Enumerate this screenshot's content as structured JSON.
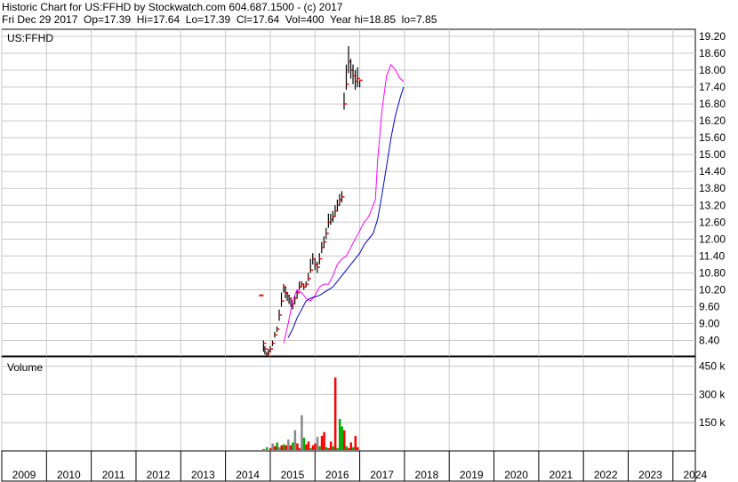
{
  "header": {
    "line1": "Historic Chart for US:FFHD by Stockwatch.com 604.687.1500 - (c) 2017",
    "line2": "Fri Dec 29 2017  Op=17.39  Hi=17.64  Lo=17.39  Cl=17.64  Vol=400  Year hi=18.85  lo=7.85"
  },
  "colors": {
    "grid": "#c8c8c8",
    "price_bar": "#000000",
    "price_point": "#ff0000",
    "ma_short": "#ff00ff",
    "ma_long": "#0000cc",
    "vol_up": "#00b000",
    "vol_down": "#ff0000",
    "vol_neutral": "#888888"
  },
  "chart_data": [
    {
      "type": "line",
      "title": "US:FFHD",
      "ylim": [
        7.85,
        19.45
      ],
      "yticks": [
        "19.20",
        "18.60",
        "18.00",
        "17.40",
        "16.80",
        "16.20",
        "15.60",
        "15.00",
        "14.40",
        "13.80",
        "13.20",
        "12.60",
        "12.00",
        "11.40",
        "10.80",
        "10.20",
        "9.60",
        "9.00",
        "8.40"
      ],
      "ytick_values": [
        19.2,
        18.6,
        18.0,
        17.4,
        16.8,
        16.2,
        15.6,
        15.0,
        14.4,
        13.8,
        13.2,
        12.6,
        12.0,
        11.4,
        10.8,
        10.2,
        9.6,
        9.0,
        8.4
      ],
      "xlim": [
        2009.0,
        2024.5
      ],
      "xticks": [
        "2009",
        "2010",
        "2011",
        "2012",
        "2013",
        "2014",
        "2015",
        "2016",
        "2017",
        "2018",
        "2019",
        "2020",
        "2021",
        "2022",
        "2023",
        "2024"
      ],
      "xtick_values": [
        2009,
        2010,
        2011,
        2012,
        2013,
        2014,
        2015,
        2016,
        2017,
        2018,
        2019,
        2020,
        2021,
        2022,
        2023,
        2024
      ],
      "series": [
        {
          "key": "price",
          "x": [
            2014.85,
            2014.88,
            2014.92,
            2014.96,
            2015.0,
            2015.05,
            2015.1,
            2015.15,
            2015.2,
            2015.25,
            2015.3,
            2015.34,
            2015.38,
            2015.42,
            2015.46,
            2015.5,
            2015.55,
            2015.6,
            2015.65,
            2015.7,
            2015.75,
            2015.8,
            2015.85,
            2015.9,
            2015.95,
            2016.0,
            2016.05,
            2016.1,
            2016.15,
            2016.2,
            2016.25,
            2016.3,
            2016.35,
            2016.4,
            2016.45,
            2016.5,
            2016.55,
            2016.6,
            2016.65,
            2016.7,
            2016.75,
            2016.8,
            2016.85,
            2016.9,
            2016.95,
            2017.0,
            2017.05,
            2017.1,
            2017.15,
            2017.2,
            2017.25,
            2017.3,
            2017.35,
            2017.38,
            2017.42,
            2017.46,
            2017.5,
            2017.54,
            2017.58,
            2017.62,
            2017.66,
            2017.7,
            2017.74,
            2017.78,
            2017.82,
            2017.86,
            2017.9,
            2017.94,
            2017.98
          ],
          "close": [
            8.3,
            8.1,
            7.9,
            8.0,
            8.1,
            8.3,
            8.6,
            8.8,
            9.3,
            9.8,
            10.3,
            10.1,
            10.0,
            9.9,
            9.8,
            9.7,
            9.9,
            10.1,
            10.3,
            10.4,
            10.3,
            10.4,
            10.6,
            10.9,
            11.3,
            11.1,
            11.0,
            11.3,
            11.7,
            11.9,
            12.2,
            12.6,
            12.7,
            12.8,
            13.0,
            13.2,
            13.4,
            13.5,
            16.8,
            17.5,
            18.3,
            18.0,
            17.8,
            17.6,
            17.7,
            17.64
          ],
          "high": [
            8.4,
            8.2,
            8.0,
            8.1,
            8.2,
            8.4,
            8.7,
            8.9,
            9.5,
            10.1,
            10.4,
            10.3,
            10.1,
            10.0,
            9.9,
            9.8,
            10.0,
            10.2,
            10.5,
            10.5,
            10.4,
            10.5,
            10.8,
            11.3,
            11.5,
            11.3,
            11.2,
            11.5,
            11.9,
            12.1,
            12.4,
            12.9,
            12.9,
            13.0,
            13.2,
            13.4,
            13.6,
            13.7,
            17.2,
            18.2,
            18.85,
            18.4,
            18.2,
            18.0,
            18.1,
            17.64
          ],
          "low": [
            8.0,
            7.9,
            7.85,
            7.9,
            8.0,
            8.2,
            8.5,
            8.7,
            9.1,
            9.6,
            10.1,
            9.9,
            9.8,
            9.7,
            9.6,
            9.5,
            9.7,
            9.9,
            10.2,
            10.3,
            10.2,
            10.3,
            10.5,
            10.8,
            11.1,
            10.9,
            10.8,
            11.1,
            11.5,
            11.7,
            12.0,
            12.4,
            12.5,
            12.6,
            12.8,
            13.0,
            13.2,
            13.3,
            16.6,
            17.3,
            17.9,
            17.7,
            17.5,
            17.3,
            17.4,
            17.39
          ]
        },
        {
          "key": "ma_short",
          "x": [
            2015.3,
            2015.4,
            2015.5,
            2015.6,
            2015.7,
            2015.8,
            2015.9,
            2016.0,
            2016.1,
            2016.2,
            2016.3,
            2016.4,
            2016.5,
            2016.6,
            2016.7,
            2016.8,
            2016.9,
            2017.0,
            2017.1,
            2017.2,
            2017.25,
            2017.3,
            2017.35,
            2017.4,
            2017.5,
            2017.6,
            2017.7,
            2017.8,
            2017.9,
            2017.98
          ],
          "values": [
            8.3,
            9.0,
            9.8,
            10.2,
            10.1,
            9.9,
            9.8,
            10.0,
            10.3,
            10.4,
            10.4,
            10.7,
            11.1,
            11.3,
            11.4,
            11.7,
            12.0,
            12.3,
            12.6,
            12.8,
            13.0,
            13.2,
            13.4,
            14.8,
            16.6,
            17.8,
            18.2,
            18.0,
            17.7,
            17.6
          ]
        },
        {
          "key": "ma_long",
          "x": [
            2015.4,
            2015.5,
            2015.6,
            2015.7,
            2015.8,
            2015.9,
            2016.0,
            2016.1,
            2016.2,
            2016.3,
            2016.4,
            2016.5,
            2016.6,
            2016.7,
            2016.8,
            2016.9,
            2017.0,
            2017.1,
            2017.2,
            2017.3,
            2017.4,
            2017.5,
            2017.6,
            2017.7,
            2017.8,
            2017.9,
            2017.98
          ],
          "values": [
            8.5,
            8.8,
            9.2,
            9.5,
            9.8,
            9.9,
            9.95,
            10.0,
            10.1,
            10.2,
            10.3,
            10.5,
            10.7,
            10.9,
            11.1,
            11.3,
            11.5,
            11.8,
            12.0,
            12.2,
            12.7,
            13.6,
            14.6,
            15.6,
            16.4,
            17.0,
            17.4
          ]
        }
      ]
    },
    {
      "type": "bar",
      "title": "Volume",
      "ylim": [
        0,
        500
      ],
      "yticks": [
        "450 k",
        "300 k",
        "150 k"
      ],
      "ytick_values": [
        450,
        300,
        150
      ],
      "series": [
        {
          "key": "volume",
          "x": [
            2014.85,
            2014.92,
            2015.0,
            2015.05,
            2015.1,
            2015.15,
            2015.2,
            2015.25,
            2015.3,
            2015.35,
            2015.4,
            2015.45,
            2015.5,
            2015.55,
            2015.6,
            2015.65,
            2015.7,
            2015.75,
            2015.8,
            2015.85,
            2015.9,
            2015.95,
            2016.0,
            2016.05,
            2016.1,
            2016.15,
            2016.2,
            2016.25,
            2016.3,
            2016.35,
            2016.4,
            2016.45,
            2016.5,
            2016.55,
            2016.6,
            2016.65,
            2016.7,
            2016.75,
            2016.8,
            2016.85,
            2016.9,
            2016.95
          ],
          "values": [
            10,
            20,
            15,
            40,
            25,
            45,
            20,
            30,
            35,
            30,
            60,
            30,
            45,
            110,
            40,
            15,
            190,
            70,
            35,
            50,
            15,
            30,
            40,
            75,
            25,
            80,
            100,
            20,
            15,
            50,
            25,
            390,
            15,
            170,
            130,
            110,
            25,
            15,
            45,
            20,
            80,
            20
          ],
          "dir": [
            "down",
            "up",
            "down",
            "neutral",
            "down",
            "up",
            "neutral",
            "down",
            "up",
            "down",
            "neutral",
            "down",
            "up",
            "neutral",
            "down",
            "down",
            "neutral",
            "up",
            "down",
            "down",
            "up",
            "down",
            "down",
            "neutral",
            "up",
            "down",
            "down",
            "up",
            "down",
            "down",
            "up",
            "down",
            "up",
            "up",
            "up",
            "down",
            "up",
            "down",
            "down",
            "up",
            "down",
            "down"
          ]
        }
      ]
    }
  ],
  "price_panel": {
    "title": "US:FFHD",
    "outlier_left": "10.0"
  },
  "volume_panel": {
    "title": "Volume"
  }
}
